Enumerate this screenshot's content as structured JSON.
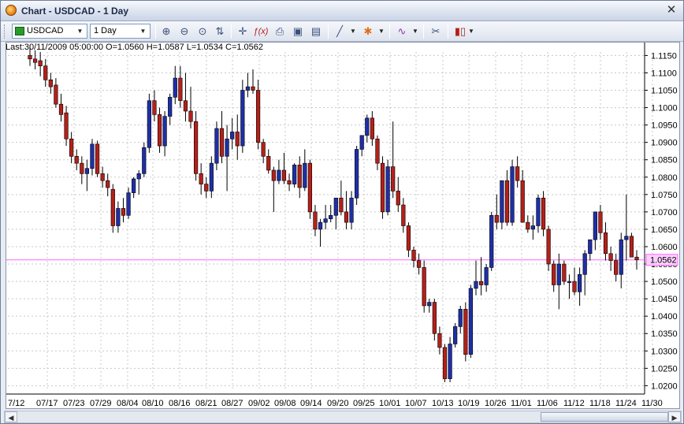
{
  "window": {
    "title": "Chart - USDCAD - 1 Day",
    "close_glyph": "✕"
  },
  "toolbar": {
    "symbol_value": "USDCAD",
    "timeframe_value": "1 Day",
    "icons": [
      "zoom-in-icon",
      "zoom-out-icon",
      "zoom-reset-icon",
      "auto-scroll-icon",
      "crosshair-icon",
      "function-icon",
      "print-icon",
      "save-icon",
      "template-icon",
      "line-tool-icon",
      "object-tool-icon",
      "indicator-icon",
      "properties-icon",
      "chart-type-icon"
    ]
  },
  "info_line": "Last:30/11/2009 05:00:00 O=1.0560 H=1.0587 L=1.0534 C=1.0562",
  "colors": {
    "bull": "#1f2fa8",
    "bear": "#b5201a",
    "price_line": "#ff66ff",
    "grid": "#c8c8c8"
  },
  "chart_data": {
    "type": "candlestick",
    "symbol": "USDCAD",
    "timeframe": "1 Day",
    "y_ticks": [
      "1.1150",
      "1.1100",
      "1.1050",
      "1.1000",
      "1.0950",
      "1.0900",
      "1.0850",
      "1.0800",
      "1.0750",
      "1.0700",
      "1.0650",
      "1.0600",
      "1.0550",
      "1.0500",
      "1.0450",
      "1.0400",
      "1.0350",
      "1.0300",
      "1.0250",
      "1.0200"
    ],
    "x_ticks": [
      "7/12",
      "07/17",
      "07/23",
      "07/29",
      "08/04",
      "08/10",
      "08/16",
      "08/21",
      "08/27",
      "09/02",
      "09/08",
      "09/14",
      "09/20",
      "09/25",
      "10/01",
      "10/07",
      "10/13",
      "10/19",
      "10/26",
      "11/01",
      "11/06",
      "11/12",
      "11/18",
      "11/24",
      "11/30"
    ],
    "ylim": [
      1.0185,
      1.116
    ],
    "current_price_label": "1.0562",
    "current_price": 1.0562,
    "grid": true,
    "candles": [
      [
        1.115,
        1.118,
        1.112,
        1.114
      ],
      [
        1.114,
        1.1165,
        1.111,
        1.113
      ],
      [
        1.1135,
        1.116,
        1.109,
        1.112
      ],
      [
        1.112,
        1.114,
        1.106,
        1.108
      ],
      [
        1.108,
        1.11,
        1.104,
        1.106
      ],
      [
        1.1065,
        1.1085,
        1.1,
        1.101
      ],
      [
        1.101,
        1.104,
        1.096,
        1.098
      ],
      [
        1.0985,
        1.1005,
        1.089,
        1.091
      ],
      [
        1.091,
        1.093,
        1.084,
        1.086
      ],
      [
        1.086,
        1.088,
        1.082,
        1.084
      ],
      [
        1.084,
        1.086,
        1.078,
        1.081
      ],
      [
        1.081,
        1.085,
        1.076,
        1.0825
      ],
      [
        1.0825,
        1.091,
        1.0805,
        1.0895
      ],
      [
        1.0895,
        1.0905,
        1.08,
        1.081
      ],
      [
        1.081,
        1.083,
        1.077,
        1.079
      ],
      [
        1.079,
        1.081,
        1.0745,
        1.077
      ],
      [
        1.0765,
        1.078,
        1.064,
        1.066
      ],
      [
        1.066,
        1.073,
        1.064,
        1.071
      ],
      [
        1.071,
        1.074,
        1.067,
        1.069
      ],
      [
        1.069,
        1.077,
        1.068,
        1.0755
      ],
      [
        1.0755,
        1.08,
        1.074,
        1.0795
      ],
      [
        1.0795,
        1.082,
        1.075,
        1.081
      ],
      [
        1.081,
        1.09,
        1.08,
        1.0885
      ],
      [
        1.0885,
        1.104,
        1.087,
        1.102
      ],
      [
        1.102,
        1.105,
        1.096,
        1.098
      ],
      [
        1.098,
        1.1,
        1.087,
        1.089
      ],
      [
        1.089,
        1.099,
        1.086,
        1.0975
      ],
      [
        1.0975,
        1.104,
        1.095,
        1.103
      ],
      [
        1.103,
        1.112,
        1.101,
        1.1085
      ],
      [
        1.1085,
        1.112,
        1.1,
        1.102
      ],
      [
        1.102,
        1.11,
        1.096,
        1.099
      ],
      [
        1.099,
        1.106,
        1.094,
        1.096
      ],
      [
        1.096,
        1.099,
        1.079,
        1.081
      ],
      [
        1.081,
        1.084,
        1.075,
        1.078
      ],
      [
        1.078,
        1.08,
        1.074,
        1.076
      ],
      [
        1.076,
        1.086,
        1.074,
        1.084
      ],
      [
        1.084,
        1.096,
        1.082,
        1.094
      ],
      [
        1.094,
        1.099,
        1.084,
        1.086
      ],
      [
        1.086,
        1.095,
        1.076,
        1.091
      ],
      [
        1.091,
        1.097,
        1.088,
        1.093
      ],
      [
        1.093,
        1.098,
        1.085,
        1.089
      ],
      [
        1.089,
        1.108,
        1.087,
        1.105
      ],
      [
        1.105,
        1.11,
        1.103,
        1.106
      ],
      [
        1.106,
        1.111,
        1.104,
        1.105
      ],
      [
        1.105,
        1.108,
        1.088,
        1.09
      ],
      [
        1.09,
        1.091,
        1.084,
        1.086
      ],
      [
        1.086,
        1.088,
        1.081,
        1.082
      ],
      [
        1.082,
        1.083,
        1.07,
        1.079
      ],
      [
        1.079,
        1.085,
        1.078,
        1.082
      ],
      [
        1.082,
        1.087,
        1.078,
        1.079
      ],
      [
        1.079,
        1.081,
        1.076,
        1.078
      ],
      [
        1.078,
        1.084,
        1.077,
        1.0835
      ],
      [
        1.0835,
        1.086,
        1.074,
        1.077
      ],
      [
        1.077,
        1.088,
        1.076,
        1.084
      ],
      [
        1.084,
        1.085,
        1.068,
        1.07
      ],
      [
        1.07,
        1.072,
        1.063,
        1.065
      ],
      [
        1.065,
        1.068,
        1.06,
        1.067
      ],
      [
        1.067,
        1.072,
        1.065,
        1.068
      ],
      [
        1.068,
        1.072,
        1.067,
        1.069
      ],
      [
        1.069,
        1.074,
        1.065,
        1.074
      ],
      [
        1.074,
        1.079,
        1.069,
        1.07
      ],
      [
        1.07,
        1.076,
        1.065,
        1.067
      ],
      [
        1.067,
        1.076,
        1.065,
        1.074
      ],
      [
        1.074,
        1.089,
        1.072,
        1.088
      ],
      [
        1.088,
        1.092,
        1.086,
        1.092
      ],
      [
        1.092,
        1.098,
        1.09,
        1.097
      ],
      [
        1.097,
        1.099,
        1.089,
        1.091
      ],
      [
        1.091,
        1.092,
        1.082,
        1.084
      ],
      [
        1.084,
        1.086,
        1.068,
        1.07
      ],
      [
        1.07,
        1.085,
        1.069,
        1.083
      ],
      [
        1.083,
        1.096,
        1.074,
        1.076
      ],
      [
        1.076,
        1.08,
        1.07,
        1.072
      ],
      [
        1.072,
        1.074,
        1.064,
        1.066
      ],
      [
        1.066,
        1.067,
        1.057,
        1.059
      ],
      [
        1.059,
        1.06,
        1.054,
        1.056
      ],
      [
        1.056,
        1.058,
        1.052,
        1.054
      ],
      [
        1.054,
        1.056,
        1.041,
        1.043
      ],
      [
        1.043,
        1.045,
        1.041,
        1.044
      ],
      [
        1.044,
        1.045,
        1.033,
        1.035
      ],
      [
        1.035,
        1.037,
        1.029,
        1.031
      ],
      [
        1.031,
        1.032,
        1.021,
        1.022
      ],
      [
        1.022,
        1.034,
        1.021,
        1.032
      ],
      [
        1.032,
        1.038,
        1.031,
        1.037
      ],
      [
        1.037,
        1.043,
        1.035,
        1.042
      ],
      [
        1.042,
        1.044,
        1.027,
        1.029
      ],
      [
        1.029,
        1.049,
        1.028,
        1.048
      ],
      [
        1.048,
        1.056,
        1.046,
        1.05
      ],
      [
        1.05,
        1.057,
        1.046,
        1.049
      ],
      [
        1.049,
        1.055,
        1.047,
        1.054
      ],
      [
        1.054,
        1.07,
        1.053,
        1.069
      ],
      [
        1.069,
        1.075,
        1.065,
        1.067
      ],
      [
        1.067,
        1.079,
        1.065,
        1.079
      ],
      [
        1.079,
        1.082,
        1.066,
        1.067
      ],
      [
        1.067,
        1.085,
        1.066,
        1.083
      ],
      [
        1.083,
        1.086,
        1.077,
        1.079
      ],
      [
        1.079,
        1.082,
        1.068,
        1.067
      ],
      [
        1.067,
        1.069,
        1.064,
        1.065
      ],
      [
        1.065,
        1.069,
        1.062,
        1.066
      ],
      [
        1.066,
        1.075,
        1.064,
        1.074
      ],
      [
        1.074,
        1.076,
        1.063,
        1.065
      ],
      [
        1.065,
        1.066,
        1.053,
        1.055
      ],
      [
        1.055,
        1.056,
        1.047,
        1.049
      ],
      [
        1.049,
        1.058,
        1.042,
        1.055
      ],
      [
        1.055,
        1.056,
        1.049,
        1.05
      ],
      [
        1.05,
        1.052,
        1.045,
        1.05
      ],
      [
        1.05,
        1.054,
        1.046,
        1.047
      ],
      [
        1.047,
        1.054,
        1.043,
        1.052
      ],
      [
        1.052,
        1.059,
        1.046,
        1.058
      ],
      [
        1.058,
        1.062,
        1.056,
        1.062
      ],
      [
        1.062,
        1.068,
        1.059,
        1.07
      ],
      [
        1.07,
        1.072,
        1.062,
        1.064
      ],
      [
        1.064,
        1.067,
        1.056,
        1.058
      ],
      [
        1.058,
        1.06,
        1.053,
        1.056
      ],
      [
        1.056,
        1.058,
        1.05,
        1.052
      ],
      [
        1.052,
        1.064,
        1.048,
        1.062
      ],
      [
        1.062,
        1.075,
        1.056,
        1.063
      ],
      [
        1.063,
        1.064,
        1.057,
        1.057
      ],
      [
        1.057,
        1.059,
        1.0534,
        1.0562
      ]
    ]
  }
}
